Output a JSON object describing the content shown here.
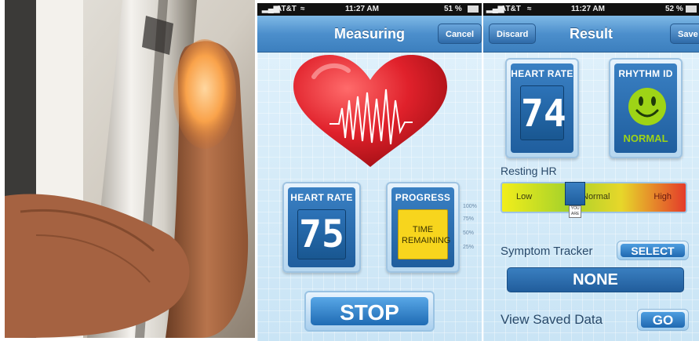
{
  "left_screen": {
    "status": {
      "carrier": "AT&T",
      "time": "11:27 AM",
      "battery": "51 %"
    },
    "nav": {
      "title": "Measuring",
      "cancel_label": "Cancel"
    },
    "heart_rate_card": {
      "label": "HEART RATE",
      "value": "75"
    },
    "progress_card": {
      "label": "PROGRESS",
      "text": "TIME REMAINING",
      "ticks": [
        "100%",
        "75%",
        "50%",
        "25%"
      ],
      "fill_fraction": 0.0
    },
    "stop_label": "STOP"
  },
  "right_screen": {
    "status": {
      "carrier": "AT&T",
      "time": "11:27 AM",
      "battery": "52 %"
    },
    "nav": {
      "title": "Result",
      "discard_label": "Discard",
      "save_label": "Save"
    },
    "heart_rate_card": {
      "label": "HEART RATE",
      "value": "74"
    },
    "rhythm_card": {
      "label": "RHYTHM ID",
      "status": "NORMAL"
    },
    "resting_hr": {
      "label": "Resting HR",
      "low": "Low",
      "normal": "Normal",
      "high": "High",
      "marker": "YOU ARE",
      "marker_fraction": 0.4
    },
    "symptom": {
      "label": "Symptom Tracker",
      "select_label": "SELECT",
      "value": "NONE"
    },
    "saved": {
      "label": "View Saved Data",
      "go_label": "GO"
    }
  },
  "colors": {
    "nav_blue": "#4c8fcc",
    "card_blue": "#1f5e9e",
    "progress_yellow": "#f7d51d",
    "smiley_green": "#9ed416",
    "heart_red": "#d91a24"
  }
}
